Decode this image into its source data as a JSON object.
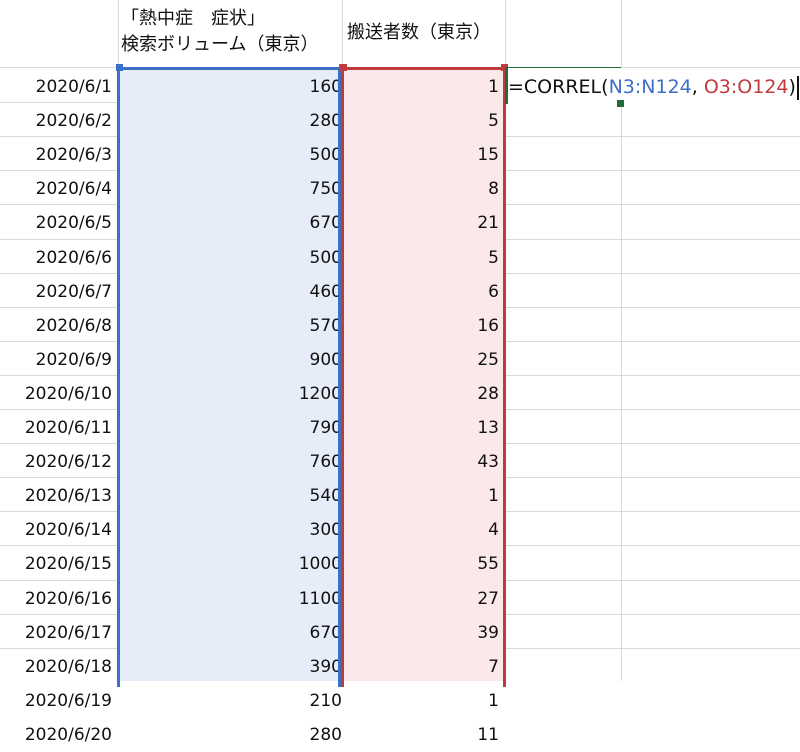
{
  "headers": {
    "col_n_line1": "「熱中症　症状」",
    "col_n_line2": "検索ボリューム（東京）",
    "col_o": "搬送者数（東京）"
  },
  "rows": [
    {
      "date": "2020/6/1",
      "volume": "160",
      "count": "1"
    },
    {
      "date": "2020/6/2",
      "volume": "280",
      "count": "5"
    },
    {
      "date": "2020/6/3",
      "volume": "500",
      "count": "15"
    },
    {
      "date": "2020/6/4",
      "volume": "750",
      "count": "8"
    },
    {
      "date": "2020/6/5",
      "volume": "670",
      "count": "21"
    },
    {
      "date": "2020/6/6",
      "volume": "500",
      "count": "5"
    },
    {
      "date": "2020/6/7",
      "volume": "460",
      "count": "6"
    },
    {
      "date": "2020/6/8",
      "volume": "570",
      "count": "16"
    },
    {
      "date": "2020/6/9",
      "volume": "900",
      "count": "25"
    },
    {
      "date": "2020/6/10",
      "volume": "1200",
      "count": "28"
    },
    {
      "date": "2020/6/11",
      "volume": "790",
      "count": "13"
    },
    {
      "date": "2020/6/12",
      "volume": "760",
      "count": "43"
    },
    {
      "date": "2020/6/13",
      "volume": "540",
      "count": "1"
    },
    {
      "date": "2020/6/14",
      "volume": "300",
      "count": "4"
    },
    {
      "date": "2020/6/15",
      "volume": "1000",
      "count": "55"
    },
    {
      "date": "2020/6/16",
      "volume": "1100",
      "count": "27"
    },
    {
      "date": "2020/6/17",
      "volume": "670",
      "count": "39"
    },
    {
      "date": "2020/6/18",
      "volume": "390",
      "count": "7"
    },
    {
      "date": "2020/6/19",
      "volume": "210",
      "count": "1"
    },
    {
      "date": "2020/6/20",
      "volume": "280",
      "count": "11"
    }
  ],
  "formula": {
    "prefix": "=CORREL(",
    "ref1": "N3:N124",
    "sep": ", ",
    "ref2": "O3:O124",
    "suffix": ")"
  },
  "colors": {
    "range1_border": "#3c6fc6",
    "range1_fill": "#e6edf9",
    "range2_border": "#c0393b",
    "range2_fill": "#fbe8e8",
    "active_border": "#1f6b3a",
    "gridline": "#d9d9d9",
    "text": "#111111"
  }
}
